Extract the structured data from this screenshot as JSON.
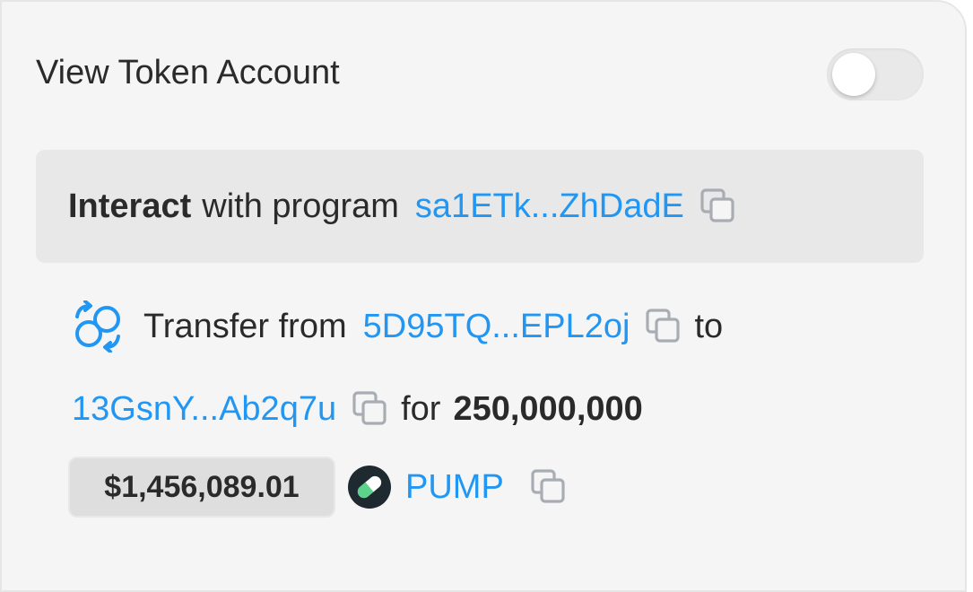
{
  "header": {
    "title": "View Token Account",
    "toggle_on": false
  },
  "instruction": {
    "bold_word": "Interact",
    "text": "with program",
    "program_address": "sa1ETk...ZhDadE"
  },
  "transfer": {
    "label": "Transfer from",
    "from_address": "5D95TQ...EPL2oj",
    "to_word": "to",
    "to_address": "13GsnY...Ab2q7u",
    "for_word": "for",
    "amount": "250,000,000",
    "usd_value": "$1,456,089.01",
    "token_symbol": "PUMP"
  },
  "icons": {
    "copy": "copy-icon",
    "transfer": "transfer-icon",
    "token": "pump-pill-icon"
  },
  "colors": {
    "link": "#2196f3",
    "text": "#2a2a2a",
    "card_bg": "#f5f5f5",
    "box_bg": "#e8e8e8",
    "badge_bg": "#dedede",
    "pill_green": "#5dd28c"
  }
}
